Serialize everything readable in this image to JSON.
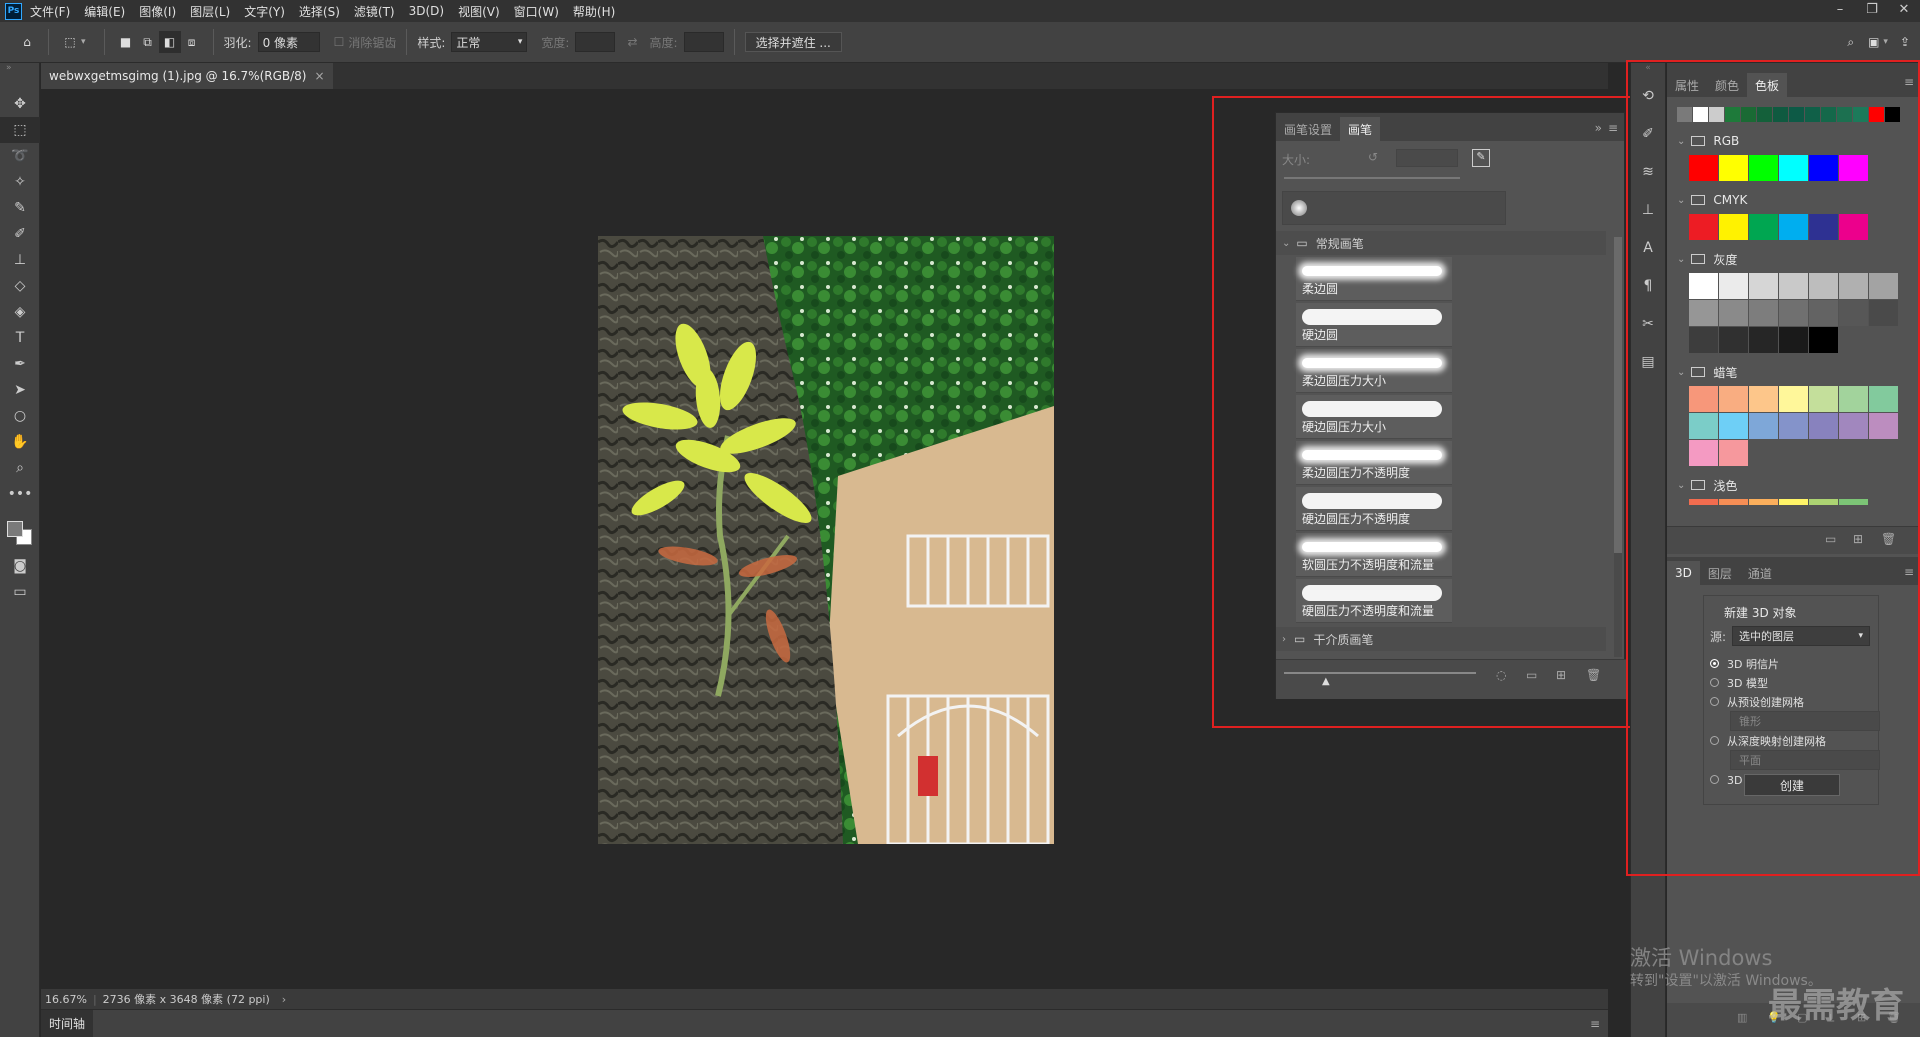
{
  "app": {
    "logo": "Ps",
    "menu": [
      "文件(F)",
      "编辑(E)",
      "图像(I)",
      "图层(L)",
      "文字(Y)",
      "选择(S)",
      "滤镜(T)",
      "3D(D)",
      "视图(V)",
      "窗口(W)",
      "帮助(H)"
    ]
  },
  "options": {
    "feather_label": "羽化:",
    "feather_value": "0 像素",
    "antialias_label": "消除锯齿",
    "style_label": "样式:",
    "style_value": "正常",
    "width_label": "宽度:",
    "height_label": "高度:",
    "select_mask_button": "选择并遮住 ..."
  },
  "document": {
    "tab_title": "webwxgetmsgimg (1).jpg @ 16.7%(RGB/8)",
    "zoom": "16.67%",
    "dimensions": "2736 像素 x 3648 像素 (72 ppi)"
  },
  "timeline": {
    "label": "时间轴"
  },
  "brush_panel": {
    "tabs": [
      "画笔设置",
      "画笔"
    ],
    "size_label": "大小:",
    "group_general": "常规画笔",
    "brushes": [
      "柔边圆",
      "硬边圆",
      "柔边圆压力大小",
      "硬边圆压力大小",
      "柔边圆压力不透明度",
      "硬边圆压力不透明度",
      "软圆压力不透明度和流量",
      "硬圆压力不透明度和流量"
    ],
    "group_dry": "干介质画笔"
  },
  "swatches_panel": {
    "tabs": [
      "属性",
      "颜色",
      "色板"
    ],
    "recent": [
      "#7a7a7a",
      "#ffffff",
      "#cccccc",
      "#1e7a3a",
      "#1a6a34",
      "#14603a",
      "#0f5a40",
      "#0d5a46",
      "#106048",
      "#14684a",
      "#1c7050",
      "#1c7a5a",
      "#ff0000",
      "#000000"
    ],
    "groups": [
      {
        "name": "RGB",
        "colors": [
          "#ff0000",
          "#ffff00",
          "#00ff00",
          "#00ffff",
          "#0000ff",
          "#ff00ff"
        ]
      },
      {
        "name": "CMYK",
        "colors": [
          "#ed1c24",
          "#fff200",
          "#00a651",
          "#00aeef",
          "#2e3192",
          "#ec008c"
        ]
      },
      {
        "name": "灰度",
        "colors": [
          "#ffffff",
          "#ebebeb",
          "#d6d6d6",
          "#c9c9c9",
          "#bdbdbd",
          "#b0b0b0",
          "#a3a3a3",
          "#969696",
          "#8a8a8a",
          "#7d7d7d",
          "#707070",
          "#636363",
          "#575757",
          "#4a4a4a",
          "#3d3d3d",
          "#303030",
          "#262626",
          "#1a1a1a",
          "#000000"
        ]
      },
      {
        "name": "蜡笔",
        "colors": [
          "#f7977a",
          "#f9ad81",
          "#fdc68a",
          "#fff79a",
          "#c4df9b",
          "#a2d39c",
          "#82ca9d",
          "#7bcdc8",
          "#6ecff6",
          "#7ea7d8",
          "#8493ca",
          "#8882be",
          "#a187be",
          "#bc8dbf",
          "#f49ac2",
          "#f6989d"
        ]
      },
      {
        "name": "浅色",
        "colors": [
          "#f26c4f",
          "#f68e55",
          "#fbaf5c",
          "#fff467",
          "#acd372",
          "#7cc576"
        ]
      }
    ]
  },
  "panel_3d": {
    "tabs": [
      "3D",
      "图层",
      "通道"
    ],
    "title": "新建 3D 对象",
    "source_label": "源:",
    "source_value": "选中的图层",
    "options": [
      "3D 明信片",
      "3D 模型",
      "从预设创建网格",
      "从深度映射创建网格",
      "3D 体积"
    ],
    "preset_value": "锥形",
    "depth_value": "平面",
    "create_button": "创建"
  },
  "watermark": {
    "line1": "激活 Windows",
    "line2": "转到\"设置\"以激活 Windows。",
    "brand": "最需教育"
  },
  "colors": {
    "highlight": "#e02020",
    "panel_bg": "#535353",
    "toolbar_bg": "#424242"
  }
}
